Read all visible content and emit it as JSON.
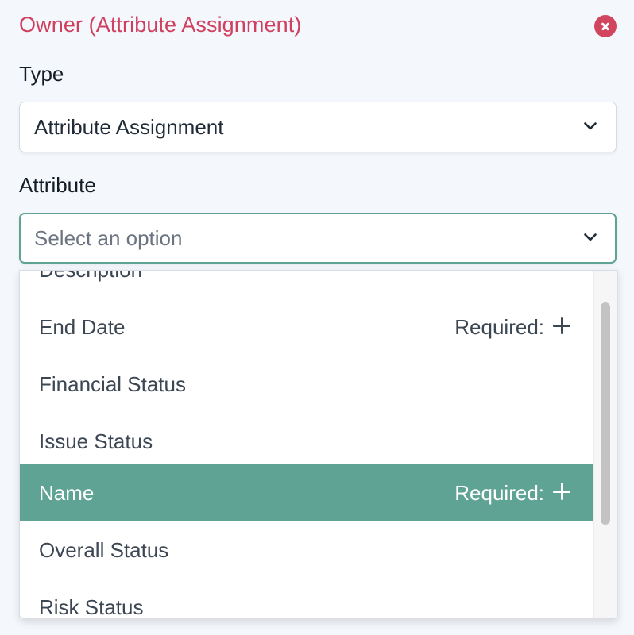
{
  "panel": {
    "title": "Owner (Attribute Assignment)"
  },
  "type_field": {
    "label": "Type",
    "value": "Attribute Assignment"
  },
  "attribute_field": {
    "label": "Attribute",
    "placeholder": "Select an option"
  },
  "dropdown": {
    "options": [
      {
        "label": "Description",
        "required_label": ""
      },
      {
        "label": "End Date",
        "required_label": "Required:"
      },
      {
        "label": "Financial Status",
        "required_label": ""
      },
      {
        "label": "Issue Status",
        "required_label": ""
      },
      {
        "label": "Name",
        "required_label": "Required:"
      },
      {
        "label": "Overall Status",
        "required_label": ""
      },
      {
        "label": "Risk Status",
        "required_label": ""
      }
    ],
    "highlighted_option": "Name"
  },
  "colors": {
    "title": "#cf3f5e",
    "close_button": "#d2455f",
    "accent": "#5ea394"
  },
  "icons": [
    "close-icon",
    "chevron-down-icon",
    "plus-icon"
  ]
}
